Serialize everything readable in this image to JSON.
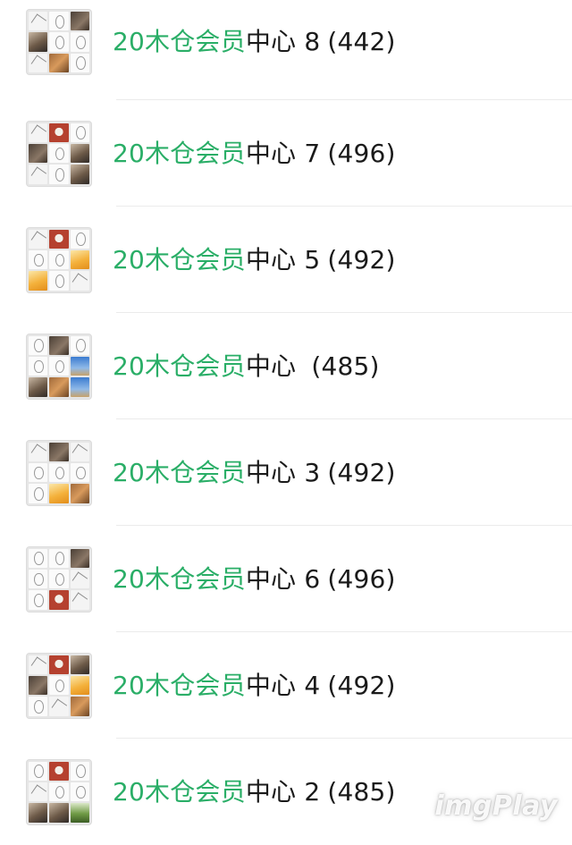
{
  "groups": [
    {
      "highlight": "20木仓会员",
      "rest": "中心 8",
      "count": "(442)",
      "tiles": [
        "t-sketch",
        "t-white",
        "t-dark",
        "t-photo",
        "t-white",
        "t-white",
        "t-sketch",
        "t-brown",
        "t-white"
      ]
    },
    {
      "highlight": "20木仓会员",
      "rest": "中心 7",
      "count": "(496)",
      "tiles": [
        "t-sketch",
        "t-red",
        "t-white",
        "t-dark",
        "t-white",
        "t-photo",
        "t-sketch",
        "t-white",
        "t-photo"
      ]
    },
    {
      "highlight": "20木仓会员",
      "rest": "中心 5",
      "count": "(492)",
      "tiles": [
        "t-sketch",
        "t-red",
        "t-white",
        "t-white",
        "t-white",
        "t-yellow",
        "t-yellow",
        "t-white",
        "t-sketch"
      ]
    },
    {
      "highlight": "20木仓会员",
      "rest": "中心 ",
      "count": "(485)",
      "tiles": [
        "t-white",
        "t-dark",
        "t-white",
        "t-white",
        "t-white",
        "t-blue",
        "t-photo",
        "t-brown",
        "t-blue"
      ]
    },
    {
      "highlight": "20木仓会员",
      "rest": "中心 3",
      "count": "(492)",
      "tiles": [
        "t-sketch",
        "t-dark",
        "t-sketch",
        "t-white",
        "t-white",
        "t-white",
        "t-white",
        "t-yellow",
        "t-brown"
      ]
    },
    {
      "highlight": "20木仓会员",
      "rest": "中心 6",
      "count": "(496)",
      "tiles": [
        "t-white",
        "t-white",
        "t-dark",
        "t-white",
        "t-white",
        "t-sketch",
        "t-white",
        "t-red",
        "t-sketch"
      ]
    },
    {
      "highlight": "20木仓会员",
      "rest": "中心 4",
      "count": "(492)",
      "tiles": [
        "t-sketch",
        "t-red",
        "t-photo",
        "t-dark",
        "t-white",
        "t-yellow",
        "t-white",
        "t-sketch",
        "t-brown"
      ]
    },
    {
      "highlight": "20木仓会员",
      "rest": "中心 2",
      "count": "(485)",
      "tiles": [
        "t-white",
        "t-red",
        "t-white",
        "t-sketch",
        "t-white",
        "t-white",
        "t-photo",
        "t-photo",
        "t-green"
      ]
    }
  ],
  "watermark": "imgPlay"
}
